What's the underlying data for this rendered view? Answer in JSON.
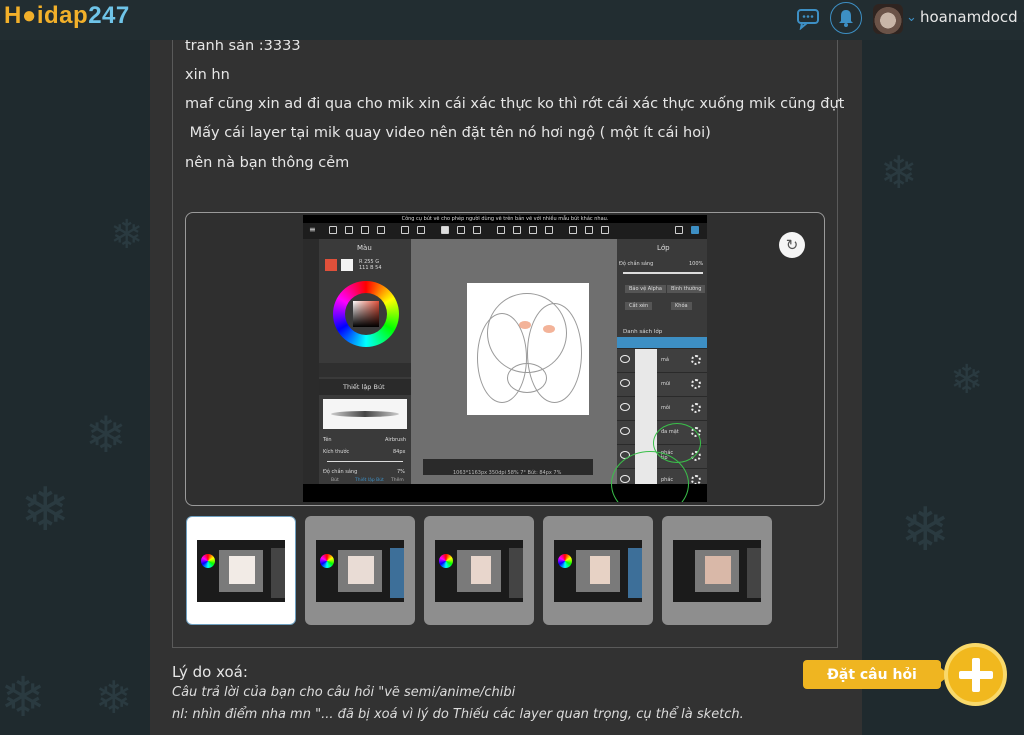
{
  "header": {
    "logo": {
      "part1": "H",
      "part2": "idap",
      "part3": "247"
    },
    "username": "hoanamdocd ..."
  },
  "post": {
    "lines": [
      "tranh sản :3333",
      "xin hn",
      "maf cũng xin ad đi qua cho mik xin cái xác thực ko thì rớt cái xác thực xuống mik cũng đựt",
      " Mấy cái layer tại mik quay video nên đặt tên nó hơi ngộ ( một ít cái hoi)",
      "nên nà bạn thông cẻm"
    ]
  },
  "screenshot": {
    "top_caption": "Công cụ bút vẽ cho phép người dùng vẽ trên bản vẽ với nhiều mẫu bút khác nhau.",
    "color_panel_title": "Màu",
    "rgb": "R 255  G 111  B 54",
    "brush_panel_title": "Thiết lập Bút",
    "brush_name_label": "Tên",
    "brush_name_value": "Airbrush",
    "brush_size_label": "Kích thước",
    "brush_size_value": "84px",
    "opacity_label": "Độ chắn sáng",
    "opacity_value": "7%",
    "layers_title": "Lớp",
    "layers_opacity_label": "Độ chắn sáng",
    "layers_opacity_value": "100%",
    "alpha_lock": "Bảo vệ Alpha",
    "blend_mode": "Bình thường",
    "clip": "Cắt xén",
    "lock": "Khóa",
    "layer_list_title": "Danh sách lớp",
    "layer_names": [
      "",
      "má",
      "mũi",
      "môi",
      "đa mặt",
      "phác\ntip",
      "phác"
    ],
    "bottom_status": "1063*1163px 350dpi 58% 7° Bút: 84px 7%",
    "bottom_tools": [
      "Bút",
      "Thiết lập Bút",
      "Thêm"
    ]
  },
  "thumbnails": {
    "count": 5,
    "active_index": 0
  },
  "deletion": {
    "title": "Lý do xoá:",
    "line1": "Câu trả lời của bạn cho câu hỏi \"vẽ semi/anime/chibi",
    "line2": "nl: nhìn điểm nha mn \"... đã bị xoá vì lý do Thiếu các layer quan trọng, cụ thể là sketch."
  },
  "ask": {
    "label": "Đặt câu hỏi"
  },
  "colors": {
    "accent_yellow": "#efb521",
    "accent_blue": "#3d8fc4",
    "panel_bg": "#323232",
    "page_bg": "#1f2a2e"
  }
}
